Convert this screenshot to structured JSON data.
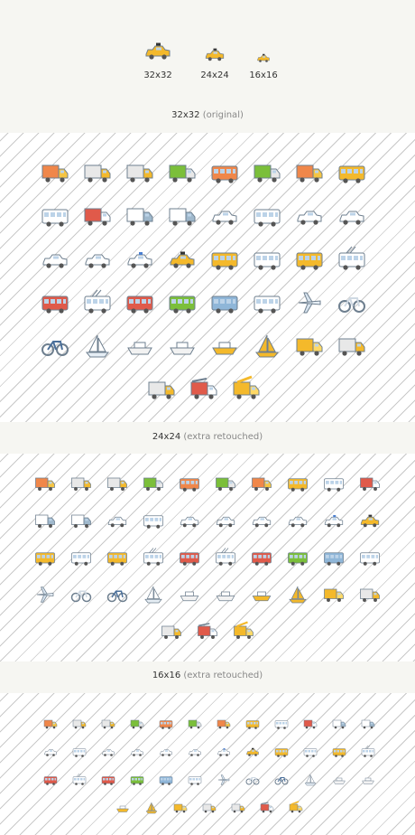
{
  "preview": {
    "items": [
      {
        "label": "32x32",
        "icon": "taxi-icon",
        "size": 32
      },
      {
        "label": "24x24",
        "icon": "taxi-icon",
        "size": 24
      },
      {
        "label": "16x16",
        "icon": "taxi-icon",
        "size": 16
      }
    ]
  },
  "sections": [
    {
      "title": "32x32",
      "note": "(original)",
      "size": 32,
      "rows": [
        [
          "orange-truck",
          "flatbed-truck",
          "tow-truck",
          "green-truck",
          "orange-double-truck",
          "green-cargo-truck",
          "orange-van-truck",
          "yellow-bus"
        ],
        [
          "white-minibus",
          "ambulance",
          "white-van",
          "white-delivery-van",
          "white-pickup",
          "white-bus",
          "white-sedan",
          "white-suv"
        ],
        [
          "white-hatchback",
          "white-limousine",
          "police-car",
          "taxi",
          "school-bus",
          "white-coach",
          "yellow-coach",
          "white-trolley-bus"
        ],
        [
          "red-double-decker",
          "white-trolleybus",
          "red-tram",
          "green-train",
          "blue-tram",
          "white-high-speed-train",
          "airplane",
          "bicycle"
        ],
        [
          "motorcycle",
          "sailboat",
          "cruise-ship",
          "white-ship",
          "yellow-boat",
          "yellow-sailship",
          "tractor",
          "cement-mixer"
        ],
        [
          "tanker-truck",
          "fire-truck",
          "crane-truck"
        ]
      ]
    },
    {
      "title": "24x24",
      "note": "(extra retouched)",
      "size": 24,
      "rows": [
        [
          "orange-truck",
          "flatbed-truck",
          "tow-truck",
          "green-truck",
          "orange-double-truck",
          "green-cargo-truck",
          "orange-van-truck",
          "yellow-bus",
          "white-minibus",
          "ambulance"
        ],
        [
          "white-van",
          "white-delivery-van",
          "white-pickup",
          "white-bus",
          "white-sedan",
          "white-suv",
          "white-hatchback",
          "white-limousine",
          "police-car",
          "taxi"
        ],
        [
          "school-bus",
          "white-coach",
          "yellow-coach",
          "white-trolley-bus",
          "red-double-decker",
          "white-trolleybus",
          "red-tram",
          "green-train",
          "blue-tram",
          "white-high-speed-train"
        ],
        [
          "airplane",
          "bicycle",
          "motorcycle",
          "sailboat",
          "cruise-ship",
          "white-ship",
          "yellow-boat",
          "yellow-sailship",
          "tractor",
          "cement-mixer"
        ],
        [
          "tanker-truck",
          "fire-truck",
          "crane-truck"
        ]
      ]
    },
    {
      "title": "16x16",
      "note": "(extra retouched)",
      "size": 16,
      "rows": [
        [
          "orange-truck",
          "flatbed-truck",
          "tow-truck",
          "green-truck",
          "orange-double-truck",
          "green-cargo-truck",
          "orange-van-truck",
          "yellow-bus",
          "white-minibus",
          "ambulance",
          "white-van",
          "white-delivery-van"
        ],
        [
          "white-pickup",
          "white-bus",
          "white-sedan",
          "white-suv",
          "white-hatchback",
          "white-limousine",
          "police-car",
          "taxi",
          "school-bus",
          "white-coach",
          "yellow-coach",
          "white-trolley-bus"
        ],
        [
          "red-double-decker",
          "white-trolleybus",
          "red-tram",
          "green-train",
          "blue-tram",
          "white-high-speed-train",
          "airplane",
          "bicycle",
          "motorcycle",
          "sailboat",
          "cruise-ship",
          "white-ship"
        ],
        [
          "yellow-boat",
          "yellow-sailship",
          "tractor",
          "cement-mixer",
          "tanker-truck",
          "fire-truck",
          "crane-truck"
        ]
      ]
    }
  ]
}
